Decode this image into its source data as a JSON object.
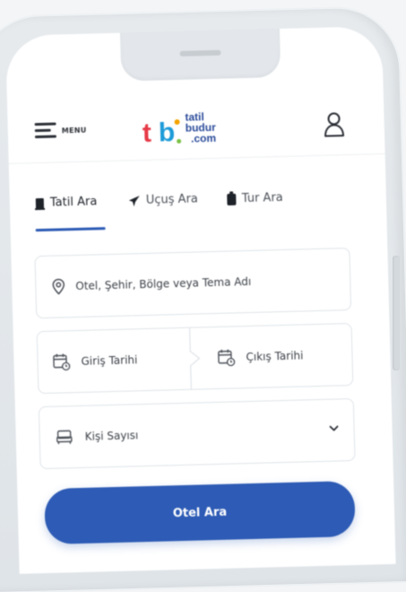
{
  "header": {
    "menu_label": "MENU",
    "logo": {
      "mark": "tb",
      "line1": "tatil",
      "line2": "budur",
      "line3": ".com"
    }
  },
  "tabs": [
    {
      "label": "Tatil Ara",
      "icon": "building-icon",
      "active": true
    },
    {
      "label": "Uçuş Ara",
      "icon": "plane-icon",
      "active": false
    },
    {
      "label": "Tur Ara",
      "icon": "luggage-icon",
      "active": false
    }
  ],
  "search": {
    "placeholder": "Otel, Şehir, Bölge veya Tema Adı",
    "checkin_label": "Giriş Tarihi",
    "checkout_label": "Çıkış Tarihi",
    "guests_label": "Kişi Sayısı"
  },
  "actions": {
    "search_button": "Otel Ara"
  },
  "colors": {
    "primary": "#2d5bb5",
    "brand_red": "#e63946",
    "brand_blue": "#1d9bd8"
  }
}
